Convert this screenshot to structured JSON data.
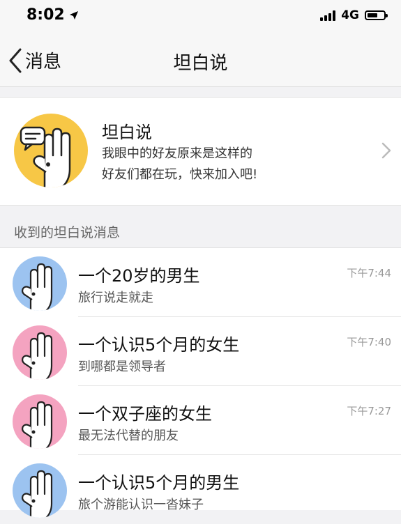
{
  "status_bar": {
    "time": "8:02",
    "network": "4G"
  },
  "nav": {
    "back_label": "消息",
    "title": "坦白说"
  },
  "promo": {
    "title": "坦白说",
    "line1": "我眼中的好友原来是这样的",
    "line2": "好友们都在玩，快来加入吧!"
  },
  "section_header": "收到的坦白说消息",
  "messages": [
    {
      "title": "一个20岁的男生",
      "subtitle": "旅行说走就走",
      "time": "下午7:44",
      "avatar_color": "#9cc3f0"
    },
    {
      "title": "一个认识5个月的女生",
      "subtitle": "到哪都是领导者",
      "time": "下午7:40",
      "avatar_color": "#f4a3c0"
    },
    {
      "title": "一个双子座的女生",
      "subtitle": "最无法代替的朋友",
      "time": "下午7:27",
      "avatar_color": "#f4a3c0"
    },
    {
      "title": "一个认识5个月的男生",
      "subtitle": "旅个游能认识一沓妹子",
      "time": "",
      "avatar_color": "#9cc3f0"
    }
  ],
  "colors": {
    "promo_logo": "#f7c746",
    "male_avatar": "#9cc3f0",
    "female_avatar": "#f4a3c0"
  },
  "icons": [
    "location-arrow-icon",
    "signal-icon",
    "battery-icon",
    "back-chevron-icon",
    "chevron-right-icon",
    "speech-bubble-icon",
    "hand-icon"
  ]
}
